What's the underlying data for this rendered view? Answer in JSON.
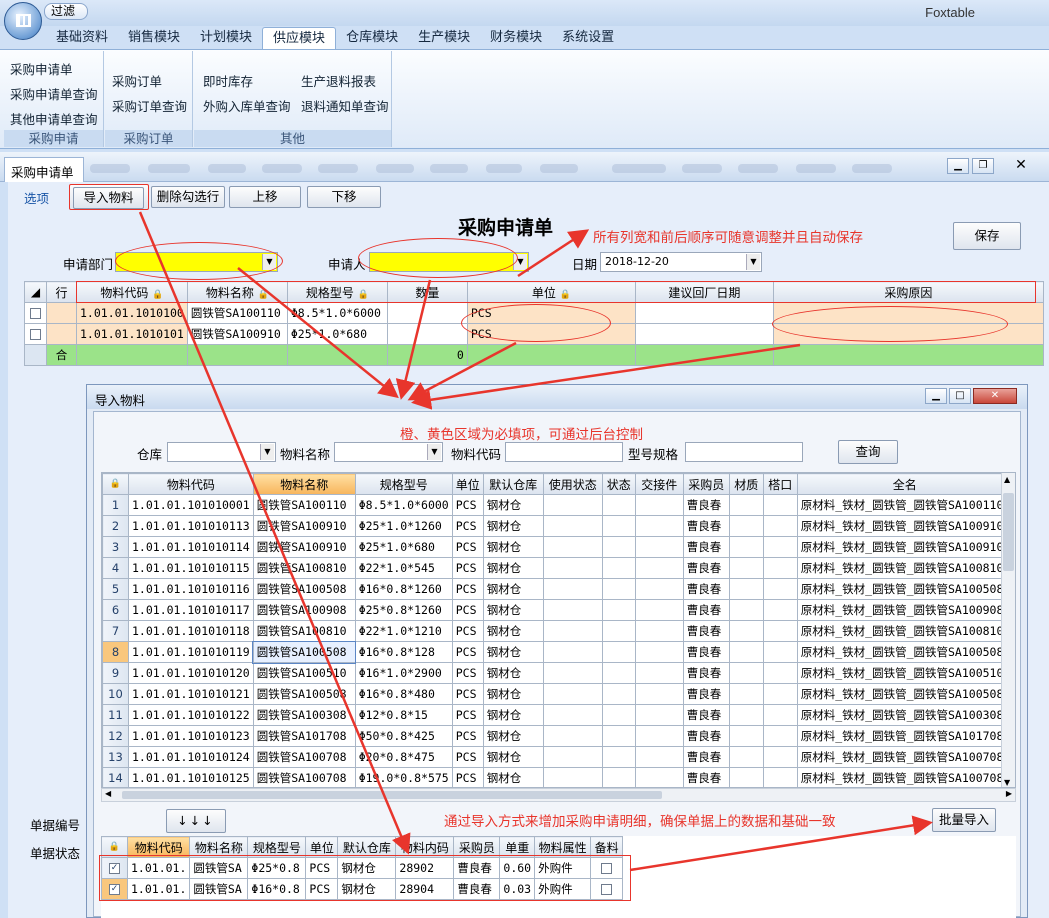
{
  "app": {
    "title": "Foxtable",
    "qat_label": "过滤"
  },
  "ribbon": {
    "tabs": [
      "基础资料",
      "销售模块",
      "计划模块",
      "供应模块",
      "仓库模块",
      "生产模块",
      "财务模块",
      "系统设置"
    ],
    "active_tab": "供应模块",
    "groups": [
      {
        "label": "采购申请",
        "items": [
          "采购申请单",
          "采购申请单查询",
          "其他申请单查询"
        ]
      },
      {
        "label": "采购订单",
        "items": [
          "采购订单",
          "采购订单查询"
        ]
      },
      {
        "label": "其他",
        "items": [
          "即时库存",
          "外购入库单查询",
          "生产退料报表",
          "退料通知单查询"
        ]
      }
    ]
  },
  "doc": {
    "tab_title": "采购申请单",
    "title": "采购申请单",
    "toolbar": {
      "options": "选项",
      "import": "导入物料",
      "delete_checked": "删除勾选行",
      "move_up": "上移",
      "move_down": "下移",
      "save": "保存"
    },
    "fields": {
      "dept_label": "申请部门",
      "applicant_label": "申请人",
      "date_label": "日期",
      "date_value": "2018-12-20",
      "doc_no_label": "单据编号",
      "doc_status_label": "单据状态"
    },
    "grid": {
      "headers": [
        "行",
        "物料代码",
        "物料名称",
        "规格型号",
        "数量",
        "单位",
        "建议回厂日期",
        "采购原因"
      ],
      "rows": [
        {
          "code": "1.01.01.1010100",
          "name": "圆铁管SA100110",
          "spec": "Φ8.5*1.0*6000",
          "qty": "",
          "unit": "PCS"
        },
        {
          "code": "1.01.01.1010101",
          "name": "圆铁管SA100910",
          "spec": "Φ25*1.0*680",
          "qty": "",
          "unit": "PCS"
        }
      ],
      "sum_label": "合",
      "sum_qty": "0"
    }
  },
  "annotations": {
    "a1": "所有列宽和前后顺序可随意调整并且自动保存",
    "a2": "橙、黄色区域为必填项，可通过后台控制",
    "a3": "通过导入方式来增加采购申请明细，确保单据上的数据和基础一致"
  },
  "dialog": {
    "title": "导入物料",
    "filters": {
      "warehouse_label": "仓库",
      "name_label": "物料名称",
      "code_label": "物料代码",
      "spec_label": "型号规格",
      "query": "查询"
    },
    "headers": [
      "物料代码",
      "物料名称",
      "规格型号",
      "单位",
      "默认仓库",
      "使用状态",
      "状态",
      "交接件",
      "采购员",
      "材质",
      "榙口",
      "全名"
    ],
    "rows": [
      {
        "n": "1",
        "code": "1.01.01.101010001",
        "name": "圆铁管SA100110",
        "spec": "Φ8.5*1.0*6000",
        "unit": "PCS",
        "wh": "钢材仓",
        "buyer": "曹良春",
        "full": "原材料_铁材_圆铁管_圆铁管SA100110"
      },
      {
        "n": "2",
        "code": "1.01.01.101010113",
        "name": "圆铁管SA100910",
        "spec": "Φ25*1.0*1260",
        "unit": "PCS",
        "wh": "钢材仓",
        "buyer": "曹良春",
        "full": "原材料_铁材_圆铁管_圆铁管SA100910"
      },
      {
        "n": "3",
        "code": "1.01.01.101010114",
        "name": "圆铁管SA100910",
        "spec": "Φ25*1.0*680",
        "unit": "PCS",
        "wh": "钢材仓",
        "buyer": "曹良春",
        "full": "原材料_铁材_圆铁管_圆铁管SA100910"
      },
      {
        "n": "4",
        "code": "1.01.01.101010115",
        "name": "圆铁管SA100810",
        "spec": "Φ22*1.0*545",
        "unit": "PCS",
        "wh": "钢材仓",
        "buyer": "曹良春",
        "full": "原材料_铁材_圆铁管_圆铁管SA100810"
      },
      {
        "n": "5",
        "code": "1.01.01.101010116",
        "name": "圆铁管SA100508",
        "spec": "Φ16*0.8*1260",
        "unit": "PCS",
        "wh": "钢材仓",
        "buyer": "曹良春",
        "full": "原材料_铁材_圆铁管_圆铁管SA100508"
      },
      {
        "n": "6",
        "code": "1.01.01.101010117",
        "name": "圆铁管SA100908",
        "spec": "Φ25*0.8*1260",
        "unit": "PCS",
        "wh": "钢材仓",
        "buyer": "曹良春",
        "full": "原材料_铁材_圆铁管_圆铁管SA100908"
      },
      {
        "n": "7",
        "code": "1.01.01.101010118",
        "name": "圆铁管SA100810",
        "spec": "Φ22*1.0*1210",
        "unit": "PCS",
        "wh": "钢材仓",
        "buyer": "曹良春",
        "full": "原材料_铁材_圆铁管_圆铁管SA100810"
      },
      {
        "n": "8",
        "code": "1.01.01.101010119",
        "name": "圆铁管SA100508",
        "spec": "Φ16*0.8*128",
        "unit": "PCS",
        "wh": "钢材仓",
        "buyer": "曹良春",
        "full": "原材料_铁材_圆铁管_圆铁管SA100508"
      },
      {
        "n": "9",
        "code": "1.01.01.101010120",
        "name": "圆铁管SA100510",
        "spec": "Φ16*1.0*2900",
        "unit": "PCS",
        "wh": "钢材仓",
        "buyer": "曹良春",
        "full": "原材料_铁材_圆铁管_圆铁管SA100510"
      },
      {
        "n": "10",
        "code": "1.01.01.101010121",
        "name": "圆铁管SA100508",
        "spec": "Φ16*0.8*480",
        "unit": "PCS",
        "wh": "钢材仓",
        "buyer": "曹良春",
        "full": "原材料_铁材_圆铁管_圆铁管SA100508"
      },
      {
        "n": "11",
        "code": "1.01.01.101010122",
        "name": "圆铁管SA100308",
        "spec": "Φ12*0.8*15",
        "unit": "PCS",
        "wh": "钢材仓",
        "buyer": "曹良春",
        "full": "原材料_铁材_圆铁管_圆铁管SA100308"
      },
      {
        "n": "12",
        "code": "1.01.01.101010123",
        "name": "圆铁管SA101708",
        "spec": "Φ50*0.8*425",
        "unit": "PCS",
        "wh": "钢材仓",
        "buyer": "曹良春",
        "full": "原材料_铁材_圆铁管_圆铁管SA101708"
      },
      {
        "n": "13",
        "code": "1.01.01.101010124",
        "name": "圆铁管SA100708",
        "spec": "Φ20*0.8*475",
        "unit": "PCS",
        "wh": "钢材仓",
        "buyer": "曹良春",
        "full": "原材料_铁材_圆铁管_圆铁管SA100708"
      },
      {
        "n": "14",
        "code": "1.01.01.101010125",
        "name": "圆铁管SA100708",
        "spec": "Φ19.0*0.8*575",
        "unit": "PCS",
        "wh": "钢材仓",
        "buyer": "曹良春",
        "full": "原材料_铁材_圆铁管_圆铁管SA100708"
      }
    ],
    "arrows_btn": "↓↓↓",
    "batch_import": "批量导入",
    "selected_headers": [
      "物料代码",
      "物料名称",
      "规格型号",
      "单位",
      "默认仓库",
      "物料内码",
      "采购员",
      "单重",
      "物料属性",
      "备料"
    ],
    "selected_rows": [
      {
        "code": "1.01.01.",
        "name": "圆铁管SA",
        "spec": "Φ25*0.8",
        "unit": "PCS",
        "wh": "钢材仓",
        "inner": "28902",
        "buyer": "曹良春",
        "weight": "0.60",
        "attr": "外购件"
      },
      {
        "code": "1.01.01.",
        "name": "圆铁管SA",
        "spec": "Φ16*0.8",
        "unit": "PCS",
        "wh": "钢材仓",
        "inner": "28904",
        "buyer": "曹良春",
        "weight": "0.03",
        "attr": "外购件"
      }
    ]
  },
  "colors": {
    "required_orange": "#fde3c6",
    "required_yellow": "#ffff00",
    "annotation_red": "#e8352c",
    "sum_green": "#9be389"
  }
}
